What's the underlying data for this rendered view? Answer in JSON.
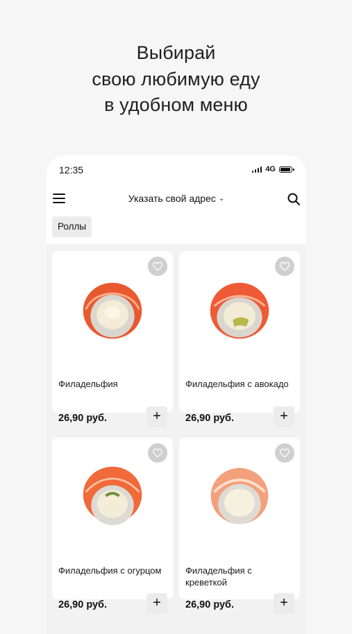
{
  "promo": {
    "lines": [
      "Выбирай",
      "свою любимую еду",
      "в удобном меню"
    ]
  },
  "status_bar": {
    "time": "12:35",
    "network": "4G",
    "icons": [
      "signal-icon",
      "battery-icon"
    ]
  },
  "header": {
    "address_label": "Указать свой адрес",
    "icons": [
      "menu-icon",
      "chevron-down-icon",
      "search-icon"
    ]
  },
  "category_chip": "Роллы",
  "products": [
    {
      "name": "Филадельфия",
      "price": "26,90 руб.",
      "add": "+"
    },
    {
      "name": "Филадельфия с авокадо",
      "price": "26,90 руб.",
      "add": "+"
    },
    {
      "name": "Филадельфия с огурцом",
      "price": "26,90 руб.",
      "add": "+"
    },
    {
      "name": "Филадельфия с креветкой",
      "price": "26,90 руб.",
      "add": "+"
    }
  ],
  "colors": {
    "page_background": "#f6f6f6",
    "card_background": "#ffffff",
    "favorite_circle": "#cfcfcf",
    "salmon": "#e8592f"
  }
}
